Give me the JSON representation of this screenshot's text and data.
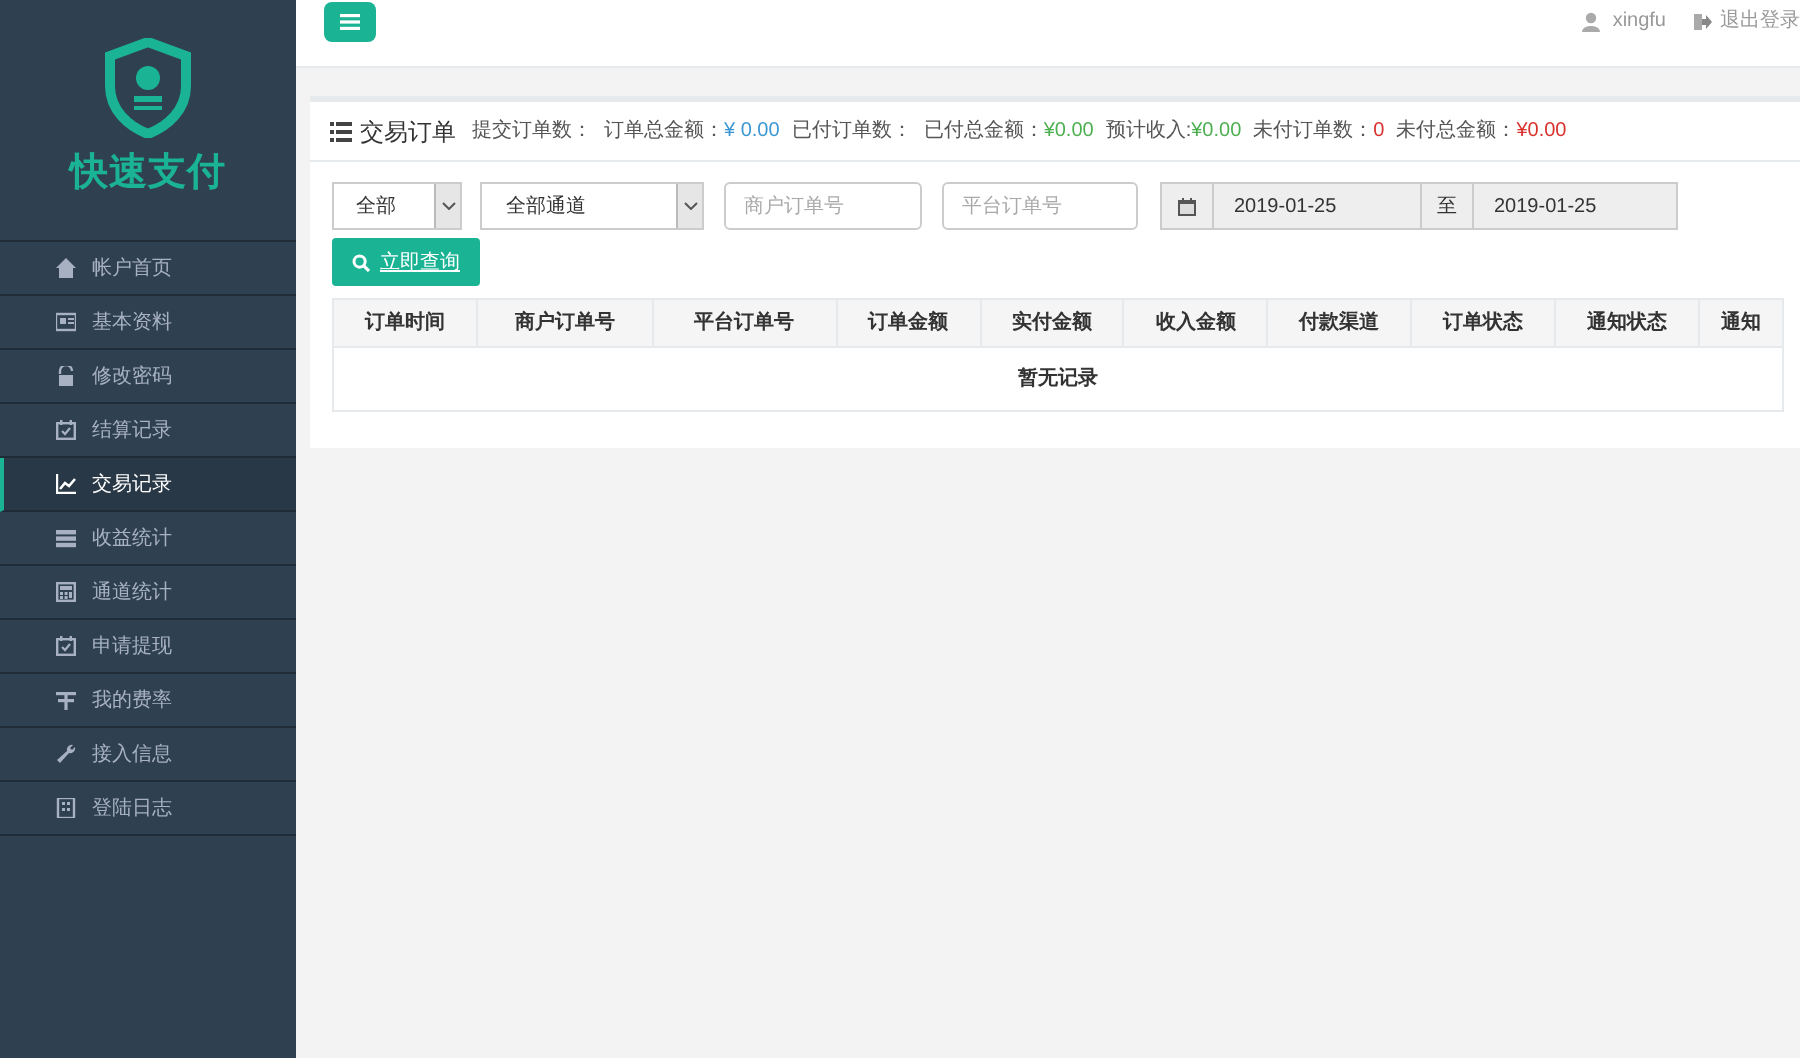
{
  "logo": {
    "text": "快速支付"
  },
  "sidebar": {
    "items": [
      {
        "label": "帐户首页",
        "selected": false
      },
      {
        "label": "基本资料",
        "selected": false
      },
      {
        "label": "修改密码",
        "selected": false
      },
      {
        "label": "结算记录",
        "selected": false
      },
      {
        "label": "交易记录",
        "selected": true
      },
      {
        "label": "收益统计",
        "selected": false
      },
      {
        "label": "通道统计",
        "selected": false
      },
      {
        "label": "申请提现",
        "selected": false
      },
      {
        "label": "我的费率",
        "selected": false
      },
      {
        "label": "接入信息",
        "selected": false
      },
      {
        "label": "登陆日志",
        "selected": false
      }
    ]
  },
  "topbar": {
    "user": "xingfu",
    "logout": "退出登录"
  },
  "panel": {
    "title": "交易订单",
    "stats": [
      {
        "label": "提交订单数："
      },
      {
        "label": "订单总金额：",
        "value": "¥ 0.00",
        "color": "#3a97d4"
      },
      {
        "label": "已付订单数："
      },
      {
        "label": "已付总金额：",
        "value": "¥0.00",
        "color": "#4caf50"
      },
      {
        "label": "预计收入:",
        "value": "¥0.00",
        "color": "#4caf50"
      },
      {
        "label": "未付订单数：",
        "value": "0",
        "color": "#d9302c"
      },
      {
        "label": "未付总金额：",
        "value": "¥0.00",
        "color": "#d9302c"
      }
    ],
    "filters": {
      "status": "全部",
      "channel": "全部通道",
      "merchant_order_placeholder": "商户订单号",
      "platform_order_placeholder": "平台订单号",
      "date_from": "2019-01-25",
      "date_separator": "至",
      "date_to": "2019-01-25"
    },
    "query_button": "立即查询",
    "table": {
      "columns": [
        "订单时间",
        "商户订单号",
        "平台订单号",
        "订单金额",
        "实付金额",
        "收入金额",
        "付款渠道",
        "订单状态",
        "通知状态",
        "通知"
      ],
      "empty": "暂无记录"
    }
  }
}
